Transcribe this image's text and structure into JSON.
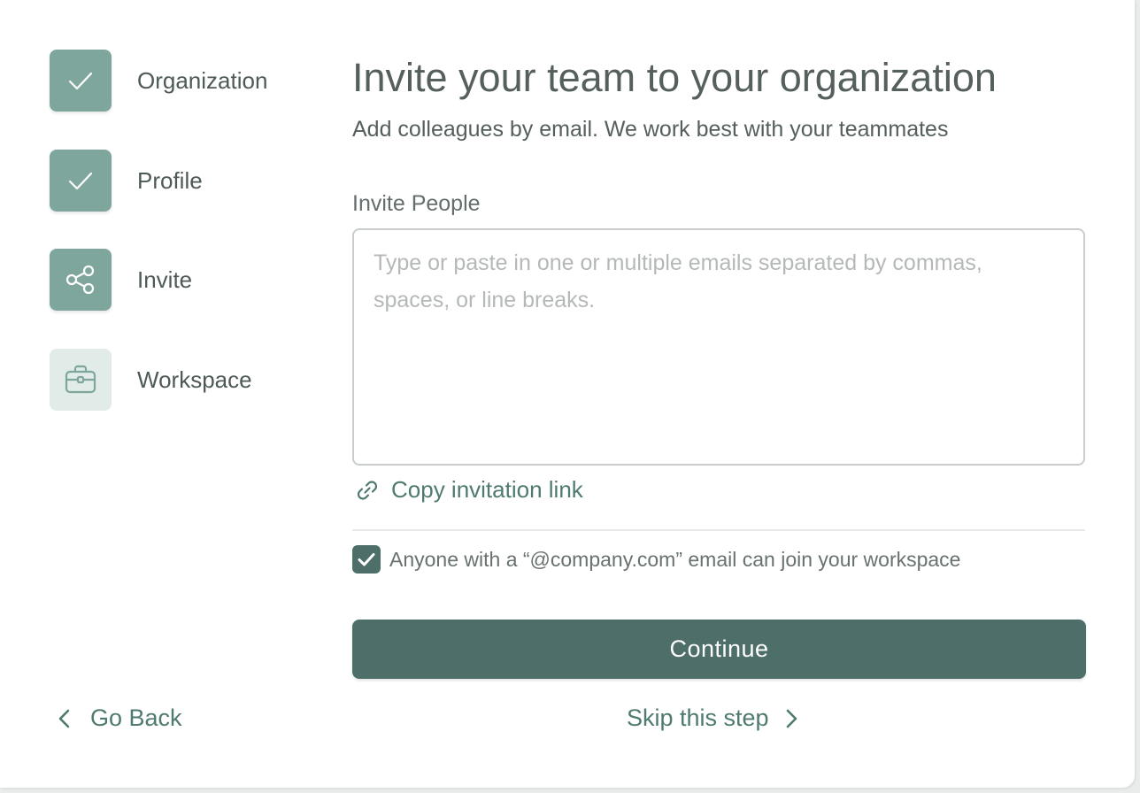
{
  "steps": [
    {
      "label": "Organization",
      "icon": "check-icon",
      "status": "complete"
    },
    {
      "label": "Profile",
      "icon": "check-icon",
      "status": "complete"
    },
    {
      "label": "Invite",
      "icon": "share-icon",
      "status": "current"
    },
    {
      "label": "Workspace",
      "icon": "briefcase-icon",
      "status": "upcoming"
    }
  ],
  "main": {
    "title": "Invite your team to your organization",
    "subtitle": "Add colleagues by email. We work best with your teammates",
    "invite_label": "Invite People",
    "invite_placeholder": "Type or paste in one or multiple emails separated by commas, spaces, or line breaks.",
    "invite_value": "",
    "copy_link_label": "Copy invitation link",
    "domain_checkbox_label": "Anyone with a “@company.com” email can join your workspace",
    "domain_checkbox_checked": true,
    "continue_label": "Continue"
  },
  "footer": {
    "back_label": "Go Back",
    "skip_label": "Skip this step"
  },
  "colors": {
    "accent": "#4e6e69",
    "step_complete": "#7fa69d",
    "step_upcoming": "#e1ebe8",
    "link": "#4e7a70"
  }
}
